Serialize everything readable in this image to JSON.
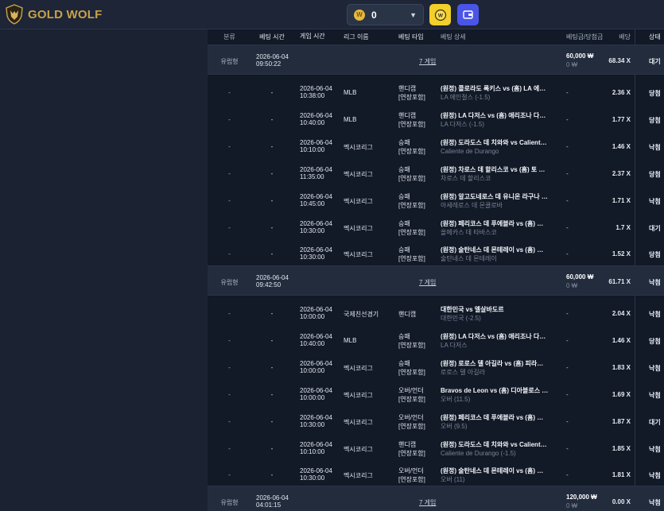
{
  "brand": {
    "name": "GOLD WOLF"
  },
  "topbar": {
    "balance": "0",
    "coin_symbol": "W"
  },
  "table": {
    "headers": {
      "type": "분류",
      "bet_time": "베팅 시간",
      "game_time": "게임 시간",
      "league": "리그 이름",
      "bet_type": "베팅 타입",
      "detail": "베팅 상세",
      "amount": "베팅금/당첨금",
      "odds": "배당",
      "status": "상태"
    },
    "groups": [
      {
        "type": "유럽형",
        "bet_date": "2026-06-04",
        "bet_time": "09:50:22",
        "games": "7 게임",
        "amount": "60,000 ₩",
        "win": "0 ₩",
        "odds": "68.34 X",
        "status": "대기",
        "rows": [
          {
            "type": "-",
            "bet": "-",
            "date": "2026-06-04",
            "time": "10:38:00",
            "league": "MLB",
            "btype1": "핸디캡",
            "btype2": "[연장포함]",
            "main": "(원정) 콜로라도 록키스 vs (홈) LA 에…",
            "sub": "LA 에인절스 (-1.5)",
            "amount": "-",
            "odds": "2.36 X",
            "status": "당첨"
          },
          {
            "type": "-",
            "bet": "-",
            "date": "2026-06-04",
            "time": "10:40:00",
            "league": "MLB",
            "btype1": "핸디캡",
            "btype2": "[연장포함]",
            "main": "(원정) LA 다저스 vs (홈) 애리조나 다…",
            "sub": "LA 다저스 (-1.5)",
            "amount": "-",
            "odds": "1.77 X",
            "status": "당첨"
          },
          {
            "type": "-",
            "bet": "-",
            "date": "2026-06-04",
            "time": "10:10:00",
            "league": "멕시코리그",
            "btype1": "승패",
            "btype2": "[연장포함]",
            "main": "(원정) 도라도스 데 치와와 vs Calient…",
            "sub": "Caliente de Durango",
            "amount": "-",
            "odds": "1.46 X",
            "status": "낙첨"
          },
          {
            "type": "-",
            "bet": "-",
            "date": "2026-06-04",
            "time": "11:35:00",
            "league": "멕시코리그",
            "btype1": "승패",
            "btype2": "[연장포함]",
            "main": "(원정) 차로스 데 할리스코 vs (홈) 토 …",
            "sub": "차로스 데 할리스코",
            "amount": "-",
            "odds": "2.37 X",
            "status": "당첨"
          },
          {
            "type": "-",
            "bet": "-",
            "date": "2026-06-04",
            "time": "10:45:00",
            "league": "멕시코리그",
            "btype1": "승패",
            "btype2": "[연장포함]",
            "main": "(원정) 알고도네로스 데 유니온 라구나 …",
            "sub": "아세레로스 데 몬클로바",
            "amount": "-",
            "odds": "1.71 X",
            "status": "낙첨"
          },
          {
            "type": "-",
            "bet": "-",
            "date": "2026-06-04",
            "time": "10:30:00",
            "league": "멕시코리그",
            "btype1": "승패",
            "btype2": "[연장포함]",
            "main": "(원정) 페리코스 데 푸에블라 vs (홈) …",
            "sub": "올메카스 데 타바스코",
            "amount": "-",
            "odds": "1.7 X",
            "status": "대기"
          },
          {
            "type": "-",
            "bet": "-",
            "date": "2026-06-04",
            "time": "10:30:00",
            "league": "멕시코리그",
            "btype1": "승패",
            "btype2": "[연장포함]",
            "main": "(원정) 술탄네스 데 몬테레이 vs (홈) …",
            "sub": "술탄네스 데 몬테레이",
            "amount": "-",
            "odds": "1.52 X",
            "status": "당첨"
          }
        ]
      },
      {
        "type": "유럽형",
        "bet_date": "2026-06-04",
        "bet_time": "09:42:50",
        "games": "7 게임",
        "amount": "60,000 ₩",
        "win": "0 ₩",
        "odds": "61.71 X",
        "status": "낙첨",
        "rows": [
          {
            "type": "-",
            "bet": "-",
            "date": "2026-06-04",
            "time": "10:00:00",
            "league": "국제친선경기",
            "btype1": "핸디캡",
            "btype2": "",
            "main": "대한민국 vs 엘살바도르",
            "sub": "대한민국 (-2.5)",
            "amount": "-",
            "odds": "2.04 X",
            "status": "낙첨"
          },
          {
            "type": "-",
            "bet": "-",
            "date": "2026-06-04",
            "time": "10:40:00",
            "league": "MLB",
            "btype1": "승패",
            "btype2": "[연장포함]",
            "main": "(원정) LA 다저스 vs (홈) 애리조나 다…",
            "sub": "LA 다저스",
            "amount": "-",
            "odds": "1.46 X",
            "status": "당첨"
          },
          {
            "type": "-",
            "bet": "-",
            "date": "2026-06-04",
            "time": "10:00:00",
            "league": "멕시코리그",
            "btype1": "승패",
            "btype2": "[연장포함]",
            "main": "(원정) 로로스 델 아길라 vs (홈) 피라…",
            "sub": "로로스 델 아길라",
            "amount": "-",
            "odds": "1.83 X",
            "status": "낙첨"
          },
          {
            "type": "-",
            "bet": "-",
            "date": "2026-06-04",
            "time": "10:00:00",
            "league": "멕시코리그",
            "btype1": "오버/언더",
            "btype2": "[연장포함]",
            "main": "Bravos de Leon vs (홈) 디아블로스 …",
            "sub": "오버 (11.5)",
            "amount": "-",
            "odds": "1.69 X",
            "status": "낙첨"
          },
          {
            "type": "-",
            "bet": "-",
            "date": "2026-06-04",
            "time": "10:30:00",
            "league": "멕시코리그",
            "btype1": "오버/언더",
            "btype2": "[연장포함]",
            "main": "(원정) 페리코스 데 푸에블라 vs (홈) …",
            "sub": "오버 (9.5)",
            "amount": "-",
            "odds": "1.87 X",
            "status": "대기"
          },
          {
            "type": "-",
            "bet": "-",
            "date": "2026-06-04",
            "time": "10:10:00",
            "league": "멕시코리그",
            "btype1": "핸디캡",
            "btype2": "[연장포함]",
            "main": "(원정) 도라도스 데 치와와 vs Calient…",
            "sub": "Caliente de Durango (-1.5)",
            "amount": "-",
            "odds": "1.85 X",
            "status": "낙첨"
          },
          {
            "type": "-",
            "bet": "-",
            "date": "2026-06-04",
            "time": "10:30:00",
            "league": "멕시코리그",
            "btype1": "오버/언더",
            "btype2": "[연장포함]",
            "main": "(원정) 술탄네스 데 몬테레이 vs (홈) …",
            "sub": "오버 (11)",
            "amount": "-",
            "odds": "1.81 X",
            "status": "낙첨"
          }
        ]
      },
      {
        "type": "유럽형",
        "bet_date": "2026-06-04",
        "bet_time": "04:01:15",
        "games": "7 게임",
        "amount": "120,000 ₩",
        "win": "0 ₩",
        "odds": "0.00 X",
        "status": "낙첨",
        "rows": []
      }
    ]
  }
}
